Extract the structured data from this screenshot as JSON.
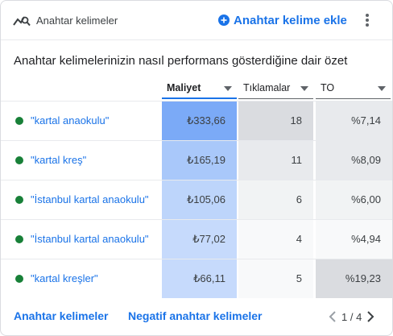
{
  "header": {
    "title": "Anahtar kelimeler",
    "add_label": "Anahtar kelime ekle"
  },
  "summary": "Anahtar kelimelerinizin nasıl performans gösterdiğine dair özet",
  "columns": [
    {
      "label": "Maliyet",
      "active": true
    },
    {
      "label": "Tıklamalar",
      "active": false
    },
    {
      "label": "TO",
      "active": false
    }
  ],
  "rows": [
    {
      "keyword": "\"kartal anaokulu\"",
      "status": "active",
      "cost": "₺333,66",
      "clicks": "18",
      "ctr": "%7,14"
    },
    {
      "keyword": "\"kartal kreş\"",
      "status": "active",
      "cost": "₺165,19",
      "clicks": "11",
      "ctr": "%8,09"
    },
    {
      "keyword": "\"İstanbul kartal anaokulu\"",
      "status": "active",
      "cost": "₺105,06",
      "clicks": "6",
      "ctr": "%6,00"
    },
    {
      "keyword": "\"İstanbul kartal anaokulu\"",
      "status": "active",
      "cost": "₺77,02",
      "clicks": "4",
      "ctr": "%4,94"
    },
    {
      "keyword": "\"kartal kreşler\"",
      "status": "active",
      "cost": "₺66,11",
      "clicks": "5",
      "ctr": "%19,23"
    }
  ],
  "footer": {
    "tab1": "Anahtar kelimeler",
    "tab2": "Negatif anahtar kelimeler",
    "page": "1 / 4"
  },
  "colors": {
    "accent": "#1a73e8",
    "status_active": "#188038"
  }
}
